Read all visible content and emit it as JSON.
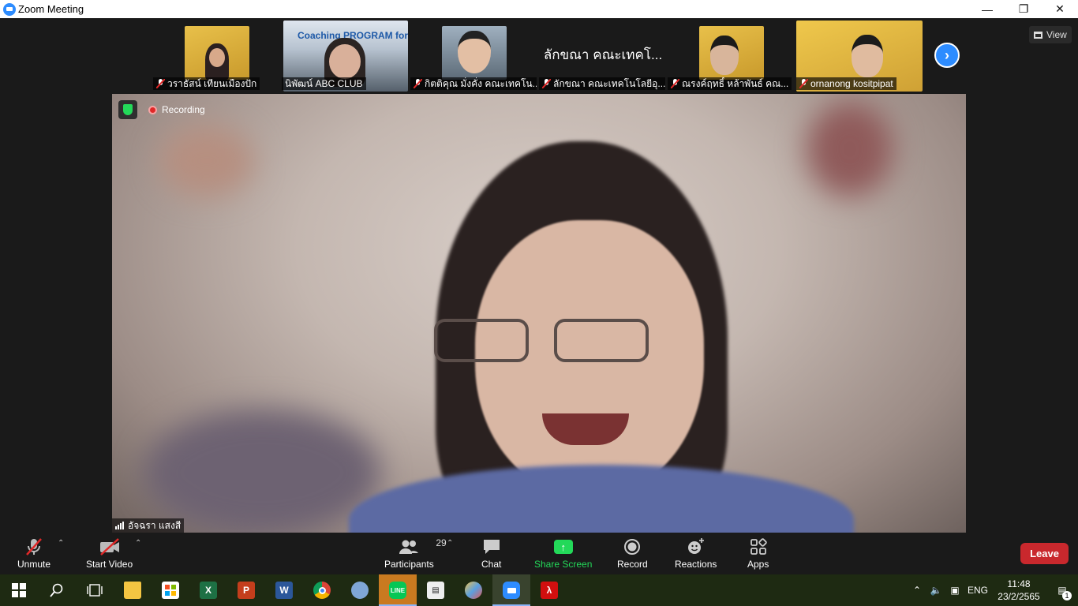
{
  "window": {
    "title": "Zoom Meeting"
  },
  "thumbnails": [
    {
      "name": "วราธัสน์ เทียนเมืองปัก",
      "kind": "video",
      "art": "#d9a93c",
      "muted": true
    },
    {
      "name": "นิพัฒน์ ABC CLUB",
      "kind": "video",
      "art": "#3a6a9a",
      "muted": false,
      "overlay": "Coaching PROGRAM for leader"
    },
    {
      "name": "กิตติคุณ มั่งคั่ง คณะเทคโน...",
      "kind": "video",
      "art": "#6a7a88",
      "muted": true
    },
    {
      "name": "ลักขณา คณะเทคโนโลยีอุ...",
      "kind": "namecard",
      "card": "ลักขณา คณะเทคโ...",
      "muted": true
    },
    {
      "name": "ณรงค์ฤทธิ์ หล้าพันธ์ คณ...",
      "kind": "video",
      "art": "#d9a93c",
      "muted": true
    },
    {
      "name": "ornanong kositpipat",
      "kind": "video",
      "art": "#e0b840",
      "muted": true
    }
  ],
  "view_button": {
    "label": "View"
  },
  "main_video": {
    "recording_label": "Recording",
    "speaker_name": "อัจฉรา แสงสี"
  },
  "toolbar": {
    "unmute": "Unmute",
    "start_video": "Start Video",
    "participants": "Participants",
    "participants_count": "29",
    "chat": "Chat",
    "share_screen": "Share Screen",
    "record": "Record",
    "reactions": "Reactions",
    "apps": "Apps",
    "leave": "Leave"
  },
  "taskbar": {
    "language": "ENG",
    "time": "11:48",
    "date": "23/2/2565",
    "notifications": "1"
  },
  "colors": {
    "accent": "#2d8cff",
    "leave": "#c9282d",
    "share": "#23d959",
    "recording": "#e02828"
  }
}
